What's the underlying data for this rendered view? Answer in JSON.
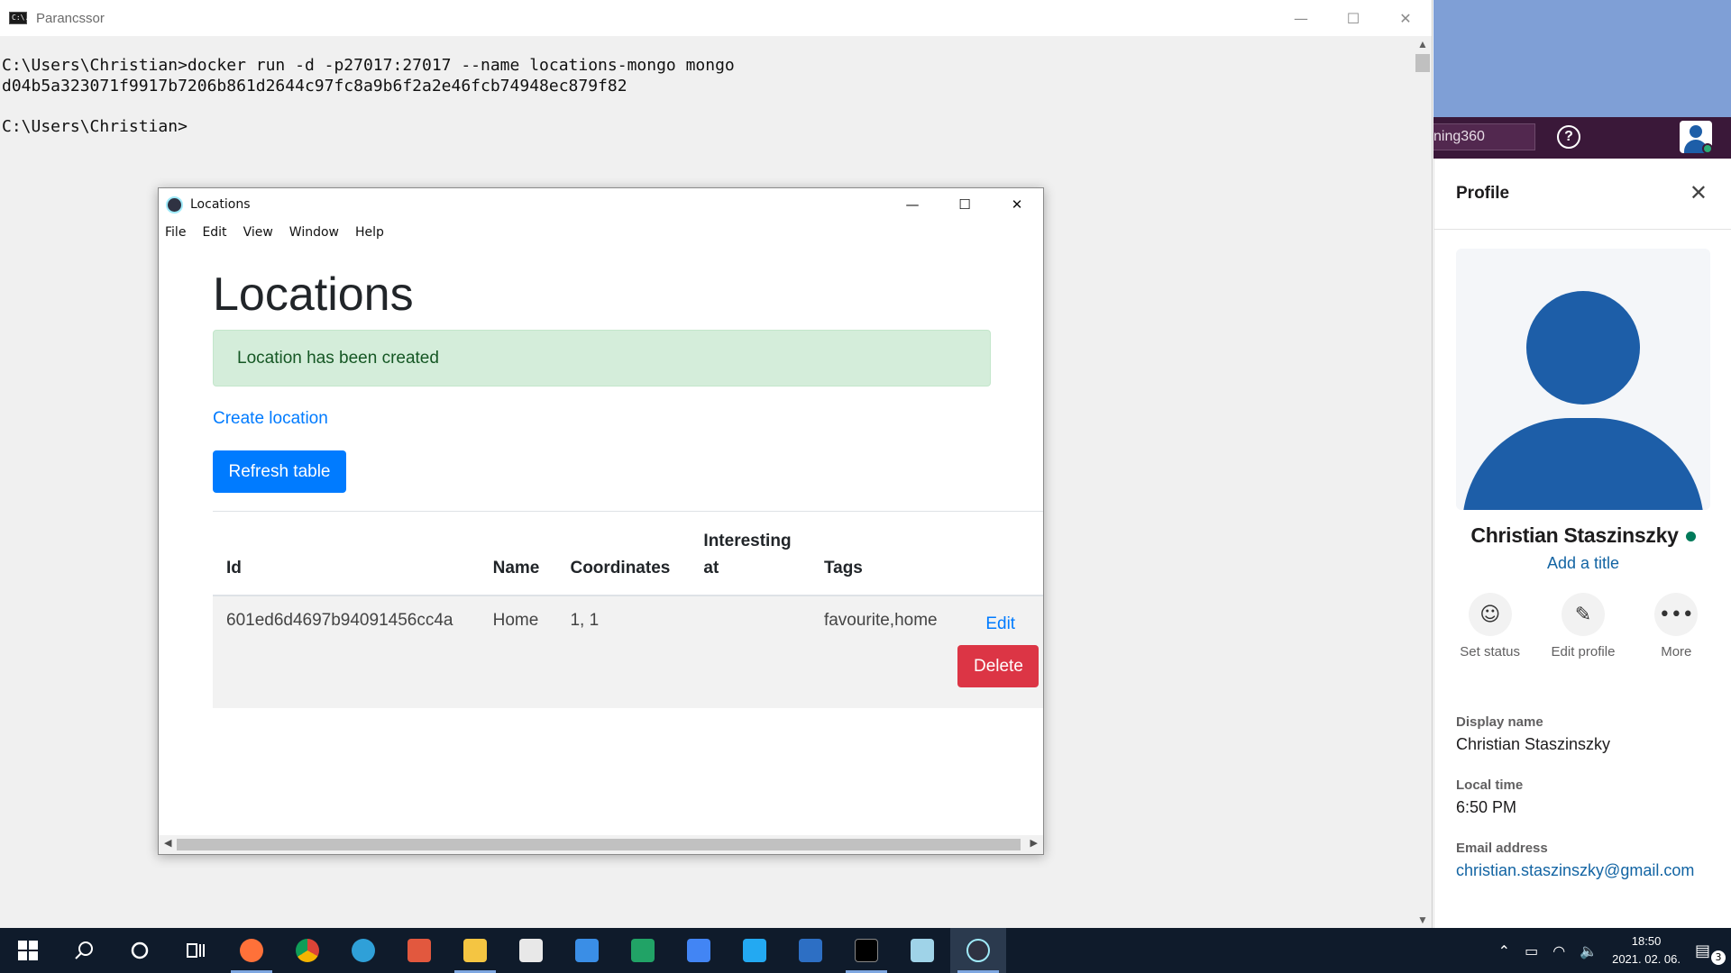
{
  "console": {
    "title": "Parancssor",
    "app_icon_text": "C:\\.",
    "lines": [
      "C:\\Users\\Christian>docker run -d -p27017:27017 --name locations-mongo mongo",
      "d04b5a323071f9917b7206b861d2644c97fc8a9b6f2a2e46fcb74948ec879f82",
      "",
      "C:\\Users\\Christian>"
    ],
    "minimize": "—",
    "maximize": "☐",
    "close": "✕"
  },
  "teams": {
    "search_text": "ning360",
    "help_icon": "?"
  },
  "profile": {
    "title": "Profile",
    "close_icon": "✕",
    "name": "Christian Staszinszky",
    "add_title": "Add a title",
    "actions": [
      {
        "icon": "☺",
        "label": "Set status"
      },
      {
        "icon": "✎",
        "label": "Edit profile"
      },
      {
        "icon": "•••",
        "label": "More"
      }
    ],
    "display_name_label": "Display name",
    "display_name_value": "Christian Staszinszky",
    "local_time_label": "Local time",
    "local_time_value": "6:50 PM",
    "email_label": "Email address",
    "email_value": "christian.staszinszky@gmail.com",
    "presence_color": "#007a5a"
  },
  "locations_window": {
    "title": "Locations",
    "menu": [
      "File",
      "Edit",
      "View",
      "Window",
      "Help"
    ],
    "minimize": "—",
    "maximize": "☐",
    "close": "✕",
    "heading": "Locations",
    "alert": "Location has been created",
    "create_link": "Create location",
    "refresh_button": "Refresh table",
    "table": {
      "headers": [
        "Id",
        "Name",
        "Coordinates",
        "Interesting at",
        "Tags"
      ],
      "rows": [
        {
          "id": "601ed6d4697b94091456cc4a",
          "name": "Home",
          "coordinates": "1, 1",
          "interesting_at": "",
          "tags": "favourite,home",
          "edit": "Edit",
          "delete": "Delete"
        }
      ]
    }
  },
  "taskbar": {
    "apps": [
      {
        "name": "start-button",
        "color": "#ffffff"
      },
      {
        "name": "search-icon",
        "color": "#ffffff"
      },
      {
        "name": "cortana-icon",
        "color": "#ffffff"
      },
      {
        "name": "task-view-icon",
        "color": "#ffffff"
      },
      {
        "name": "firefox-icon",
        "color": "#ff7139"
      },
      {
        "name": "chrome-icon",
        "color": "#db4437"
      },
      {
        "name": "edge-icon",
        "color": "#2fa0d8"
      },
      {
        "name": "doublecommander-icon",
        "color": "#e2583e"
      },
      {
        "name": "file-explorer-icon",
        "color": "#f4c542"
      },
      {
        "name": "store-icon",
        "color": "#e8e8e8"
      },
      {
        "name": "mail-icon",
        "color": "#3a8ee6"
      },
      {
        "name": "sheets-icon",
        "color": "#21a366"
      },
      {
        "name": "docs-icon",
        "color": "#4285f4"
      },
      {
        "name": "vscode-icon",
        "color": "#23a9f2"
      },
      {
        "name": "powershell-icon",
        "color": "#2d6fc4"
      },
      {
        "name": "cmd-icon",
        "color": "#000000"
      },
      {
        "name": "notepad-icon",
        "color": "#9fd3e8"
      },
      {
        "name": "electron-icon",
        "color": "#9feaf9"
      }
    ],
    "time": "18:50",
    "date": "2021. 02. 06.",
    "notification_count": "3"
  }
}
